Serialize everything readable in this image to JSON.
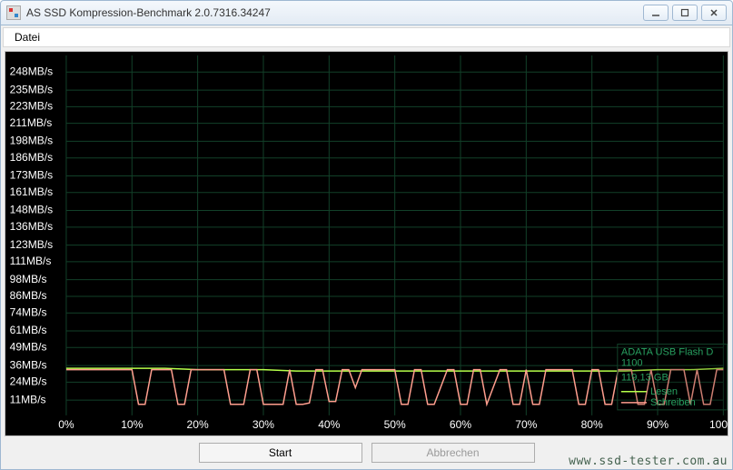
{
  "window": {
    "title": "AS SSD Kompression-Benchmark 2.0.7316.34247"
  },
  "menu": {
    "file": "Datei"
  },
  "buttons": {
    "start": "Start",
    "abort": "Abbrechen"
  },
  "legend": {
    "device": "ADATA USB Flash D",
    "model": "1100",
    "capacity": "119,13 GB",
    "read": "Lesen",
    "write": "Schreiben"
  },
  "watermark": "www.ssd-tester.com.au",
  "chart_data": {
    "type": "line",
    "title": "",
    "xlabel": "",
    "ylabel": "",
    "x_unit": "%",
    "y_unit": "MB/s",
    "xlim": [
      0,
      100
    ],
    "ylim": [
      0,
      260
    ],
    "y_ticks": [
      11,
      24,
      36,
      49,
      61,
      74,
      86,
      98,
      111,
      123,
      136,
      148,
      161,
      173,
      186,
      198,
      211,
      223,
      235,
      248
    ],
    "y_tick_labels": [
      "11MB/s",
      "24MB/s",
      "36MB/s",
      "49MB/s",
      "61MB/s",
      "74MB/s",
      "86MB/s",
      "98MB/s",
      "111MB/s",
      "123MB/s",
      "136MB/s",
      "148MB/s",
      "161MB/s",
      "173MB/s",
      "186MB/s",
      "198MB/s",
      "211MB/s",
      "223MB/s",
      "235MB/s",
      "248MB/s"
    ],
    "x_ticks": [
      0,
      10,
      20,
      30,
      40,
      50,
      60,
      70,
      80,
      90,
      100
    ],
    "x_tick_labels": [
      "0%",
      "10%",
      "20%",
      "30%",
      "40%",
      "50%",
      "60%",
      "70%",
      "80%",
      "90%",
      "100%"
    ],
    "series": [
      {
        "name": "Lesen",
        "color": "#b6ff4a",
        "x": [
          0,
          5,
          10,
          15,
          20,
          25,
          30,
          35,
          40,
          45,
          50,
          55,
          60,
          65,
          70,
          75,
          80,
          85,
          90,
          95,
          100
        ],
        "values": [
          34,
          34,
          34,
          34,
          33,
          33,
          33,
          32,
          32,
          32,
          32,
          32,
          32,
          32,
          32,
          32,
          32,
          32,
          33,
          33,
          34
        ]
      },
      {
        "name": "Schreiben",
        "color": "#ff9e8e",
        "x": [
          0,
          4,
          8,
          10,
          11,
          12,
          13,
          14,
          16,
          17,
          18,
          19,
          20,
          24,
          25,
          26,
          27,
          28,
          29,
          30,
          31,
          32,
          33,
          34,
          35,
          36,
          37,
          38,
          39,
          40,
          41,
          42,
          43,
          44,
          45,
          46,
          50,
          51,
          52,
          53,
          54,
          55,
          56,
          58,
          59,
          60,
          61,
          62,
          63,
          64,
          66,
          67,
          68,
          69,
          70,
          71,
          72,
          73,
          75,
          77,
          78,
          79,
          80,
          81,
          82,
          83,
          84,
          85,
          86,
          87,
          88,
          89,
          90,
          91,
          92,
          93,
          94,
          95,
          96,
          97,
          98,
          99,
          100
        ],
        "values": [
          33,
          33,
          33,
          33,
          8,
          8,
          33,
          33,
          33,
          8,
          8,
          33,
          33,
          33,
          8,
          8,
          8,
          33,
          33,
          8,
          8,
          8,
          8,
          33,
          8,
          8,
          9,
          33,
          33,
          10,
          10,
          33,
          33,
          20,
          33,
          33,
          33,
          8,
          8,
          33,
          33,
          8,
          8,
          33,
          33,
          8,
          8,
          33,
          33,
          8,
          33,
          33,
          8,
          8,
          33,
          8,
          8,
          33,
          33,
          33,
          8,
          8,
          33,
          33,
          8,
          8,
          33,
          33,
          33,
          8,
          8,
          33,
          8,
          8,
          33,
          33,
          33,
          8,
          33,
          8,
          8,
          33,
          33
        ]
      }
    ]
  }
}
